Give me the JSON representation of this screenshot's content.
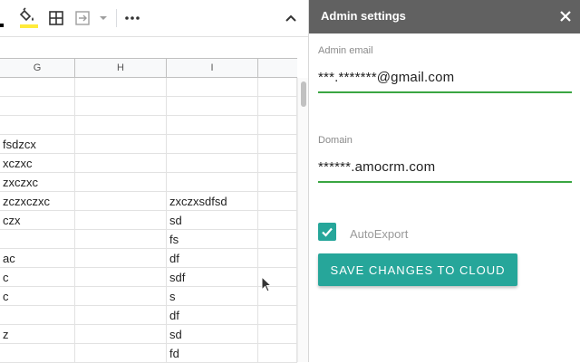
{
  "sheet": {
    "columns": [
      "G",
      "H",
      "I"
    ],
    "rows": [
      {
        "g": "",
        "i": ""
      },
      {
        "g": "",
        "i": ""
      },
      {
        "g": "",
        "i": ""
      },
      {
        "g": "fsdzcx",
        "i": ""
      },
      {
        "g": "xczxc",
        "i": ""
      },
      {
        "g": "zxczxc",
        "i": ""
      },
      {
        "g": "zczxczxc",
        "i": "zxczxsdfsd"
      },
      {
        "g": "czx",
        "i": "sd"
      },
      {
        "g": "",
        "i": "fs"
      },
      {
        "g": "ac",
        "i": "df"
      },
      {
        "g": "c",
        "i": "sdf"
      },
      {
        "g": "c",
        "i": "s"
      },
      {
        "g": "",
        "i": "df"
      },
      {
        "g": "z",
        "i": "sd"
      },
      {
        "g": "",
        "i": "fd"
      }
    ]
  },
  "panel": {
    "title": "Admin settings",
    "email_label": "Admin email",
    "email_value": "***.*******@gmail.com",
    "domain_label": "Domain",
    "domain_value": "******.amocrm.com",
    "autoexport_label": "AutoExport",
    "autoexport_checked": true,
    "save_label": "SAVE CHANGES TO CLOUD"
  },
  "colors": {
    "header_bg": "#616161",
    "accent": "#26a69a",
    "field_underline": "#3aa642"
  }
}
